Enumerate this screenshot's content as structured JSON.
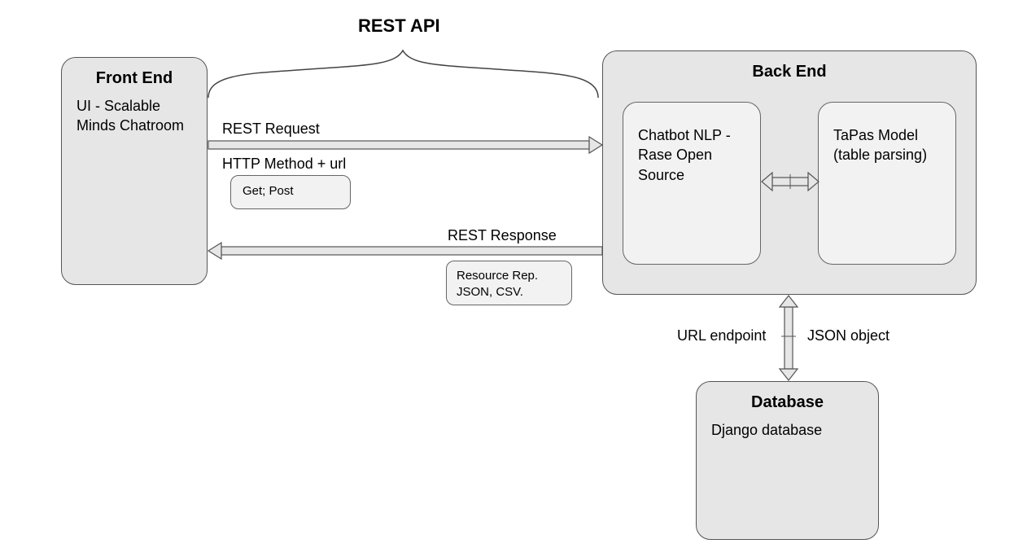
{
  "title_top": "REST API",
  "frontend": {
    "title": "Front End",
    "content": "UI - Scalable Minds Chatroom"
  },
  "backend": {
    "title": "Back End",
    "chatbot": "Chatbot NLP - Rase Open Source",
    "tapas": "TaPas Model (table parsing)"
  },
  "database": {
    "title": "Database",
    "content": "Django database"
  },
  "labels": {
    "rest_request": "REST Request",
    "http_method": "HTTP Method + url",
    "get_post": "Get; Post",
    "rest_response": "REST Response",
    "resource_rep": "Resource Rep. JSON, CSV.",
    "url_endpoint": "URL endpoint",
    "json_object": "JSON object"
  }
}
